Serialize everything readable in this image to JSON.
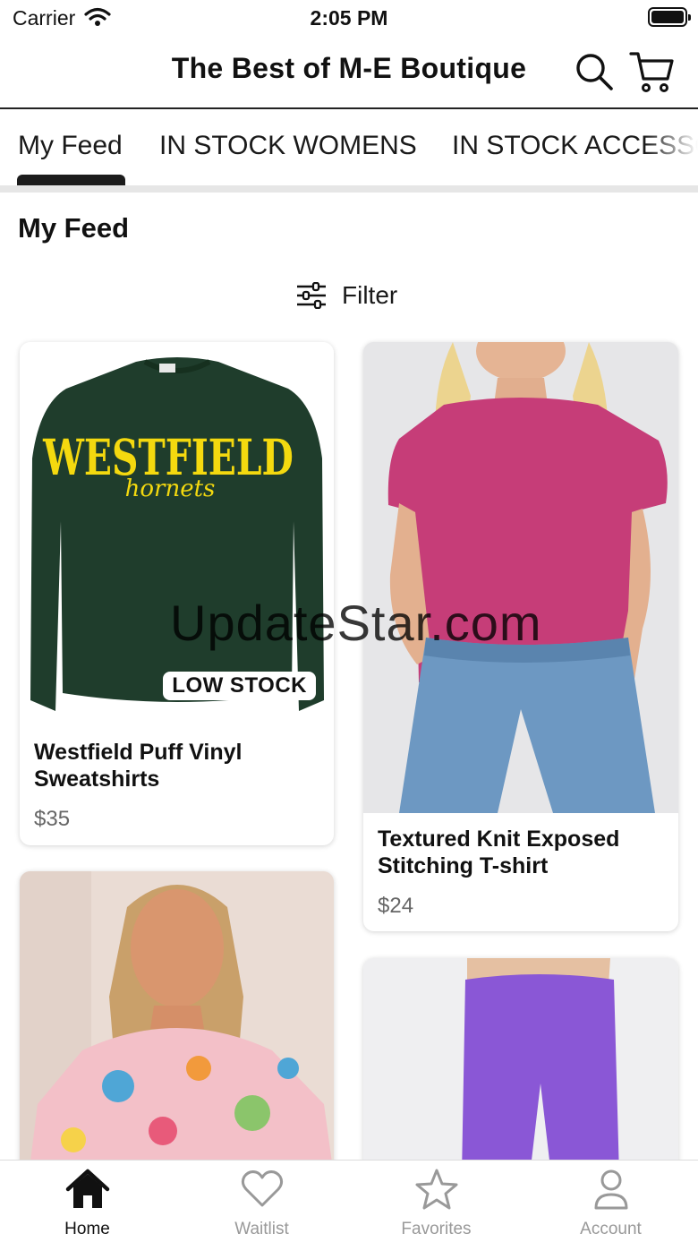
{
  "status_bar": {
    "carrier": "Carrier",
    "time": "2:05 PM"
  },
  "header": {
    "title": "The Best of M-E Boutique",
    "search_icon": "search-icon",
    "cart_icon": "cart-icon"
  },
  "tabs": [
    {
      "label": "My Feed",
      "active": true
    },
    {
      "label": "IN STOCK WOMENS",
      "active": false
    },
    {
      "label": "IN STOCK ACCESSORIES",
      "active": false
    }
  ],
  "feed": {
    "title": "My Feed",
    "filter_label": "Filter",
    "products": [
      {
        "name": "Westfield Puff Vinyl Sweatshirts",
        "price": "$35",
        "badge": "LOW STOCK",
        "sweatshirt_text": "WESTFIELD",
        "sweatshirt_script": "hornets"
      },
      {
        "name": "Textured Knit Exposed Stitching T-shirt",
        "price": "$24"
      },
      {
        "name": "",
        "price": ""
      },
      {
        "name": "",
        "price": ""
      }
    ]
  },
  "watermark": "UpdateStar.com",
  "bottom_nav": [
    {
      "label": "Home",
      "icon": "home-icon",
      "active": true
    },
    {
      "label": "Waitlist",
      "icon": "heart-icon",
      "active": false
    },
    {
      "label": "Favorites",
      "icon": "star-icon",
      "active": false
    },
    {
      "label": "Account",
      "icon": "person-icon",
      "active": false
    }
  ],
  "colors": {
    "accent": "#1c1c1c",
    "muted": "#999999",
    "sweatshirt": "#1f3d2c",
    "sweatshirt_print": "#f4d90f",
    "pink_top": "#c63d78",
    "purple": "#8a57d6"
  }
}
